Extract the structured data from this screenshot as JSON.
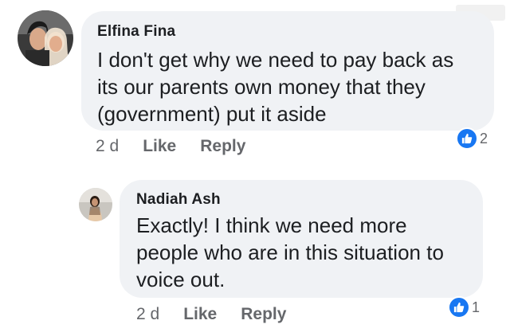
{
  "comments": [
    {
      "author": "Elfina Fina",
      "text_lines": [
        "I don't get why we need to pay back as",
        "its our parents own money that they",
        "(government) put it aside"
      ],
      "time": "2 d",
      "like_label": "Like",
      "reply_label": "Reply",
      "reaction_icon": "thumbs-up-icon",
      "reaction_count": "2"
    },
    {
      "author": "Nadiah Ash",
      "text_lines": [
        "Exactly! I think we need more",
        "people who are in this situation to",
        "voice out."
      ],
      "time": "2 d",
      "like_label": "Like",
      "reply_label": "Reply",
      "reaction_icon": "thumbs-up-icon",
      "reaction_count": "1"
    }
  ],
  "colors": {
    "bubble": "#f0f2f5",
    "text": "#1c1e21",
    "meta": "#65676b",
    "like_blue": "#1877f2"
  }
}
